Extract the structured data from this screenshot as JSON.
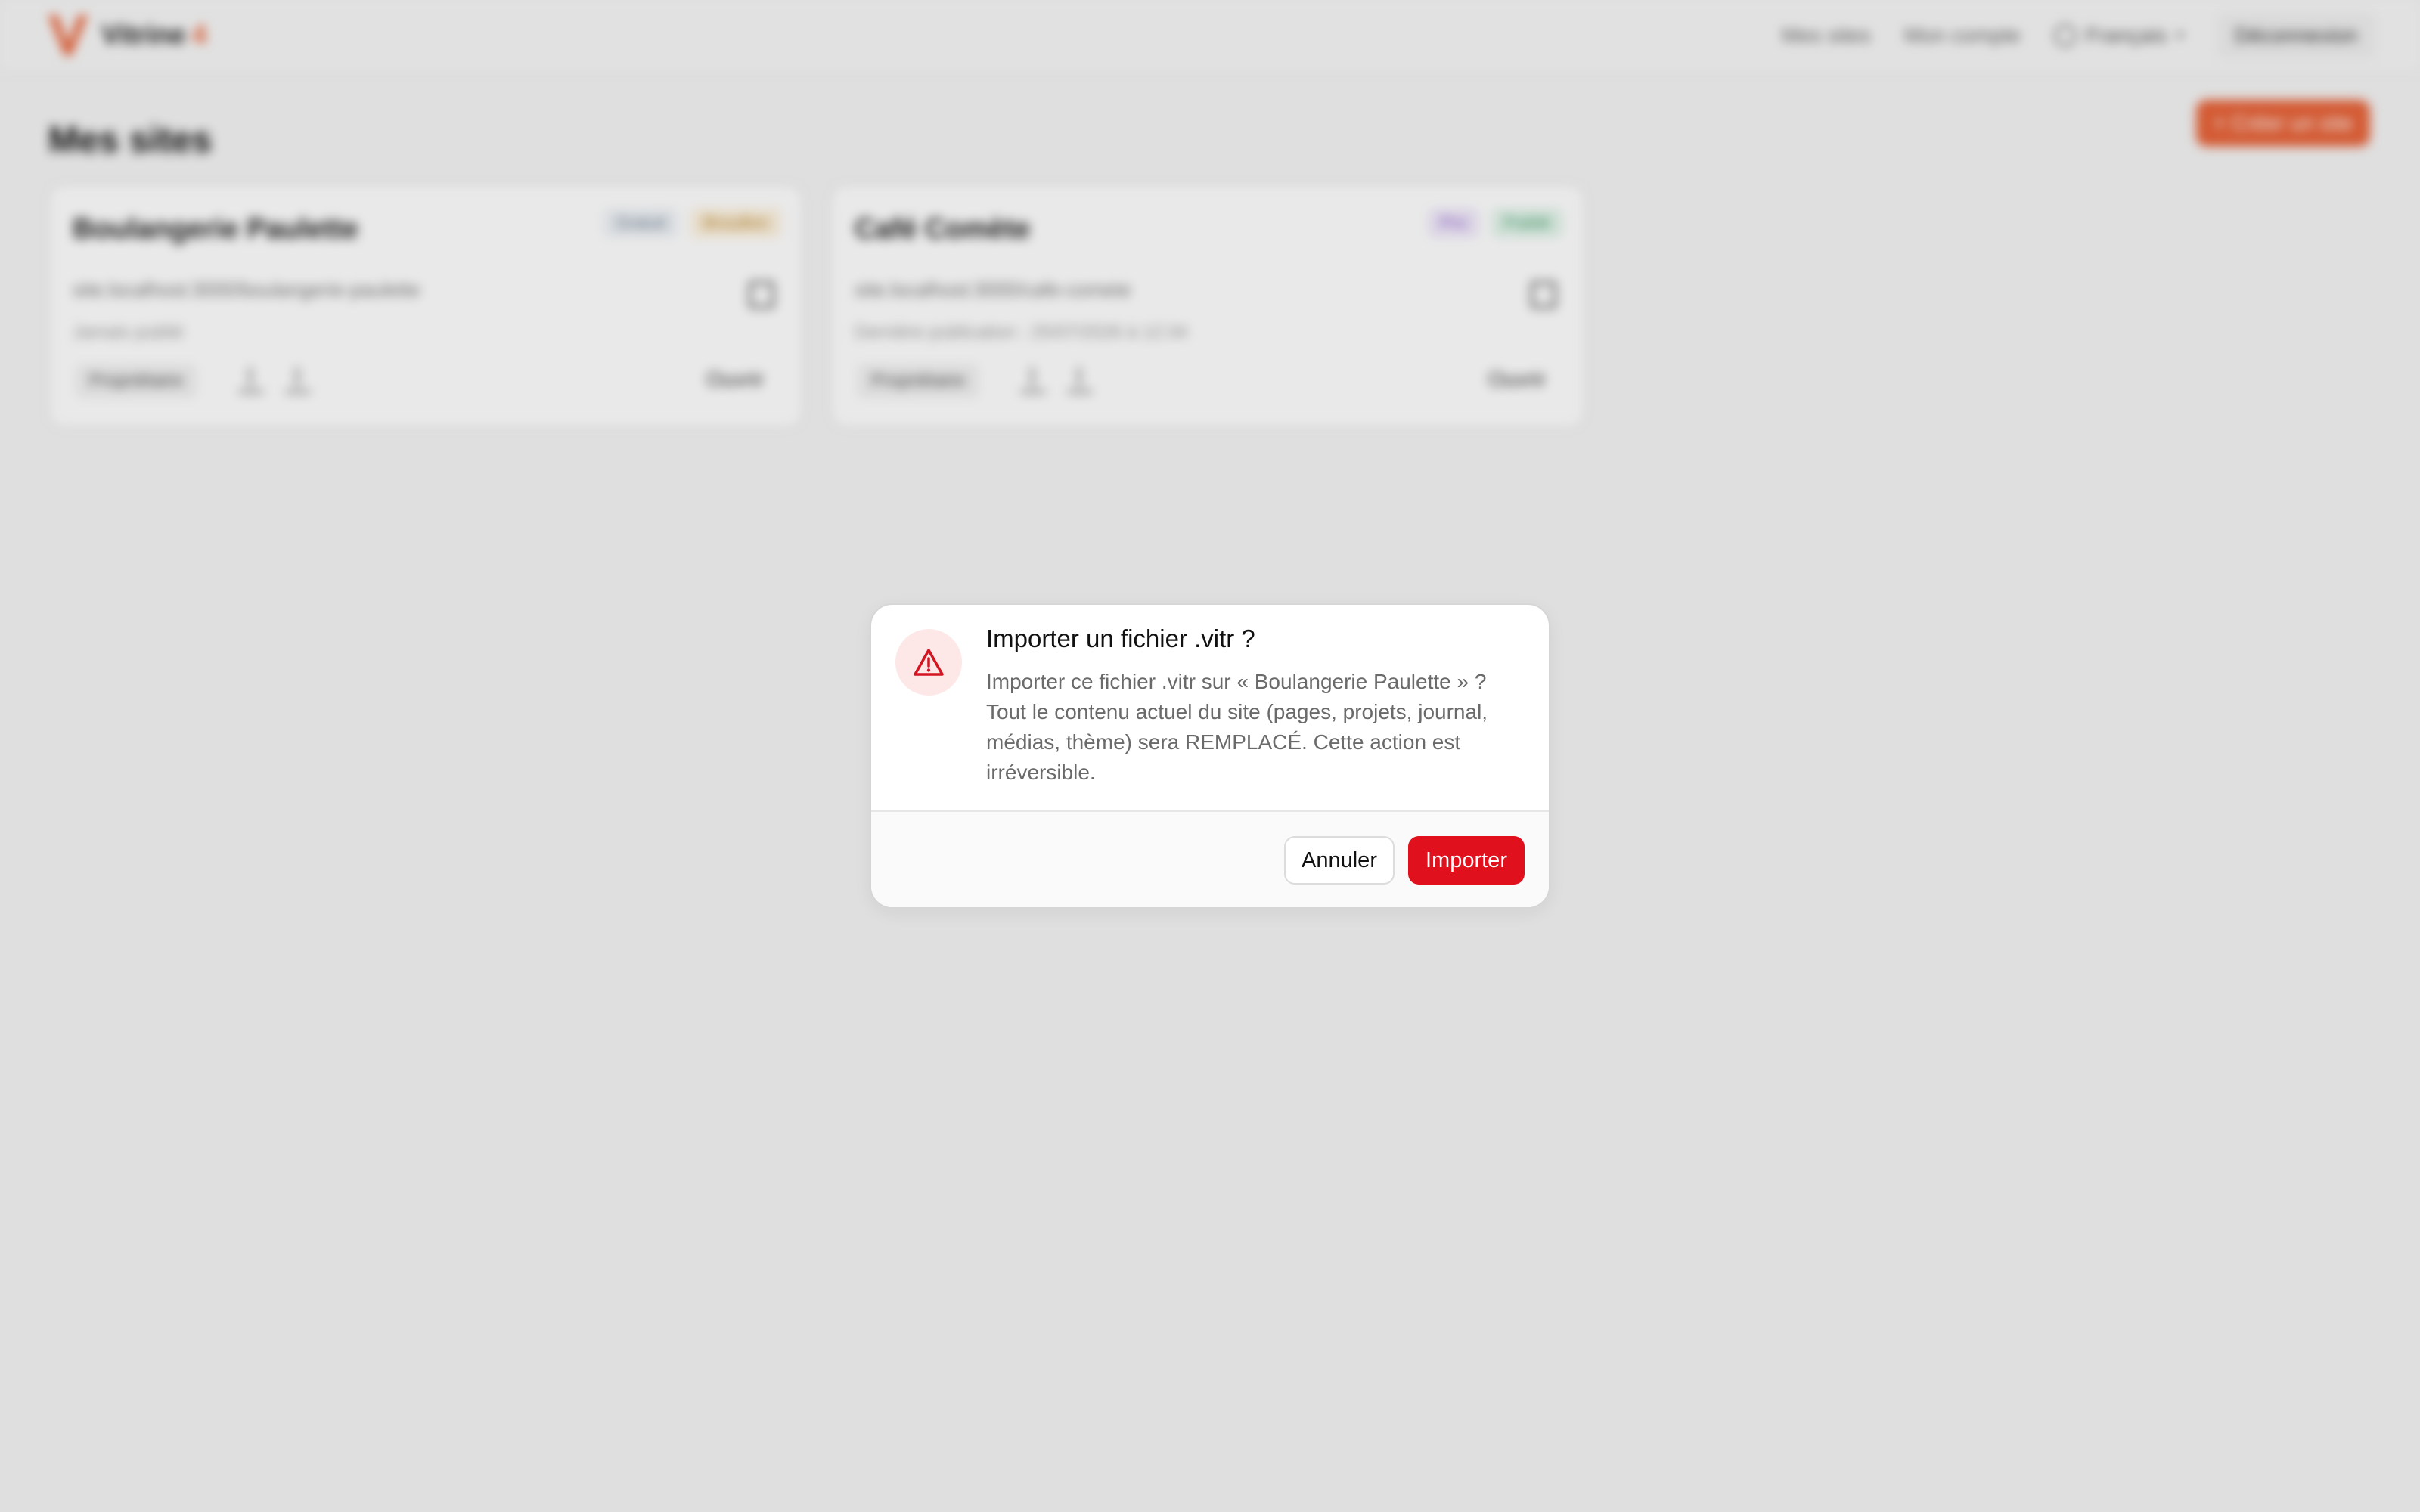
{
  "brand": {
    "name": "Vitrine",
    "suffix": "4"
  },
  "nav": {
    "my_sites": "Mes sites",
    "my_account": "Mon compte",
    "language": "Français",
    "logout": "Déconnexion"
  },
  "page": {
    "title": "Mes sites",
    "create_button": "+ Créer un site"
  },
  "sites": [
    {
      "name": "Boulangerie Paulette",
      "badges": [
        "Gratuit",
        "Brouillon"
      ],
      "url": "site.localhost:3000/boulangerie-paulette",
      "meta": "Jamais publié",
      "role": "Propriétaire",
      "open": "Ouvrir"
    },
    {
      "name": "Café Comète",
      "badges": [
        "Pro",
        "Publié"
      ],
      "url": "site.localhost:3000/cafe-comete",
      "meta": "Dernière publication : 25/07/2026 à 12:34",
      "role": "Propriétaire",
      "open": "Ouvrir"
    }
  ],
  "dialog": {
    "icon": "warning-triangle-icon",
    "title": "Importer un fichier .vitr ?",
    "body": "Importer ce fichier .vitr sur « Boulangerie Paulette » ? Tout le contenu actuel du site (pages, projets, journal, médias, thème) sera REMPLACÉ. Cette action est irréversible.",
    "cancel": "Annuler",
    "confirm": "Importer"
  },
  "colors": {
    "accent": "#e8643a",
    "danger": "#e0101c",
    "danger_soft": "#fde7e7"
  }
}
